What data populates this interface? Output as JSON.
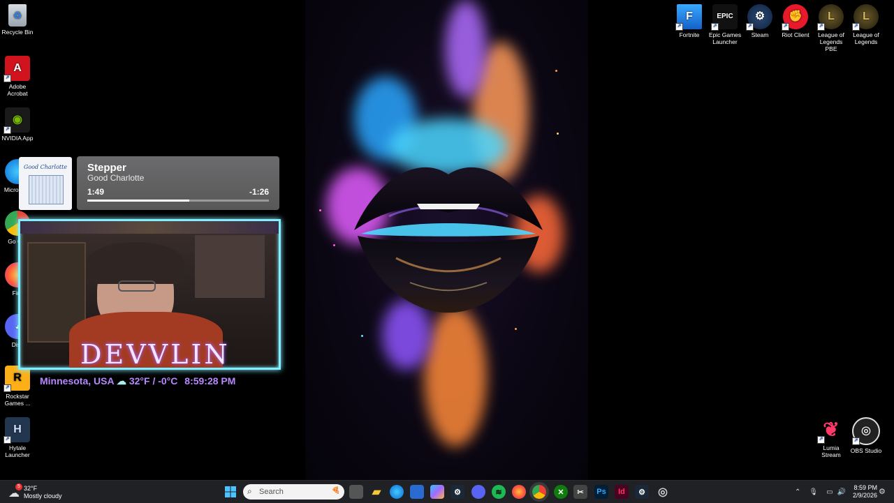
{
  "desktop_left": [
    {
      "label": "Recycle Bin",
      "icon": "recycle-bin-icon"
    },
    {
      "label": "Adobe Acrobat",
      "icon": "acrobat-icon"
    },
    {
      "label": "NVIDIA App",
      "icon": "nvidia-icon"
    },
    {
      "label": "Micro Edg",
      "icon": "edge-icon"
    },
    {
      "label": "Go Chr",
      "icon": "chrome-icon"
    },
    {
      "label": "Fire",
      "icon": "firefox-icon"
    },
    {
      "label": "Disc",
      "icon": "discord-icon"
    },
    {
      "label": "Rockstar Games ...",
      "icon": "rockstar-icon"
    },
    {
      "label": "Hytale Launcher",
      "icon": "hytale-icon"
    }
  ],
  "desktop_right": [
    {
      "label": "Fortnite",
      "icon": "fortnite-icon"
    },
    {
      "label": "Epic Games Launcher",
      "icon": "epic-games-icon"
    },
    {
      "label": "Steam",
      "icon": "steam-icon"
    },
    {
      "label": "Riot Client",
      "icon": "riot-icon"
    },
    {
      "label": "League of Legends PBE",
      "icon": "league-pbe-icon"
    },
    {
      "label": "League of Legends",
      "icon": "league-icon"
    }
  ],
  "desktop_bottom_right": [
    {
      "label": "Lumia Stream",
      "icon": "lumia-icon"
    },
    {
      "label": "OBS Studio",
      "icon": "obs-icon"
    }
  ],
  "now_playing": {
    "title": "Stepper",
    "artist": "Good Charlotte",
    "elapsed": "1:49",
    "remaining": "-1:26",
    "progress": 0.56,
    "album_text": "Good Charlotte"
  },
  "overlay": {
    "brand": "DEVVLIN",
    "location": "Minnesota, USA",
    "weather": "32°F / -0°C",
    "time": "8:59:28 PM"
  },
  "taskbar": {
    "weather_temp": "32°F",
    "weather_desc": "Mostly cloudy",
    "weather_badge": "5",
    "search_placeholder": "Search",
    "clock_time": "8:59 PM",
    "clock_date": "2/9/2026"
  },
  "colors": {
    "accent": "#7ff0ff",
    "brand_glow": "#b070ff"
  }
}
